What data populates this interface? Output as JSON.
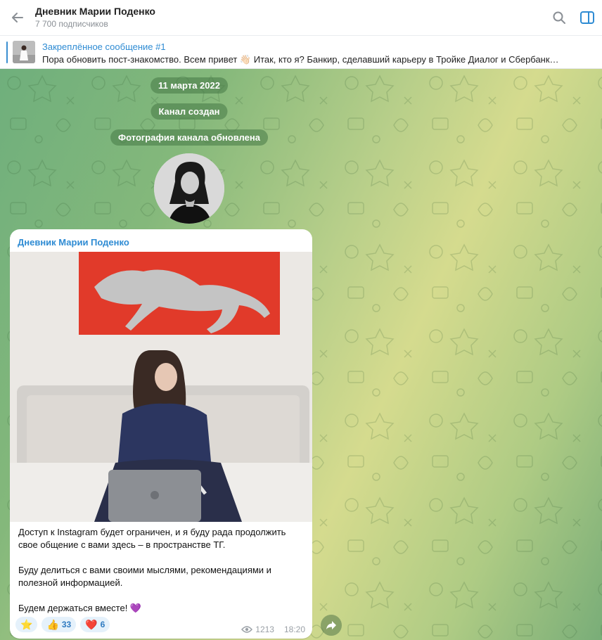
{
  "header": {
    "title": "Дневник Марии Поденко",
    "subscribers": "7 700 подписчиков"
  },
  "pinned": {
    "title": "Закреплённое сообщение #1",
    "text": "Пора обновить пост-знакомство.  Всем привет 👋🏻  Итак, кто я?  Банкир, сделавший карьеру в Тройке Диалог и Сбербанк…"
  },
  "service": {
    "date": "11 марта 2022",
    "created": "Канал создан",
    "photo_updated": "Фотография канала обновлена"
  },
  "message": {
    "author": "Дневник Марии Поденко",
    "paragraph1_line1": "Доступ к Instagram будет ограничен,  и я буду рада продолжить",
    "paragraph1_line2": "свое общение с вами здесь – в пространстве ТГ.",
    "paragraph2_line1": "Буду делиться с вами своими мыслями, рекомендациями и",
    "paragraph2_line2": "полезной информацией.",
    "paragraph3": "Будем держаться  вместе! 💜",
    "reactions": [
      {
        "icon": "⭐",
        "count": ""
      },
      {
        "icon": "👍",
        "count": "33"
      },
      {
        "icon": "❤️",
        "count": "6"
      }
    ],
    "views": "1213",
    "time": "18:20"
  },
  "colors": {
    "accent": "#2e8bd3",
    "chat_green": "#84b87b",
    "chat_yellow": "#d5db8e"
  }
}
